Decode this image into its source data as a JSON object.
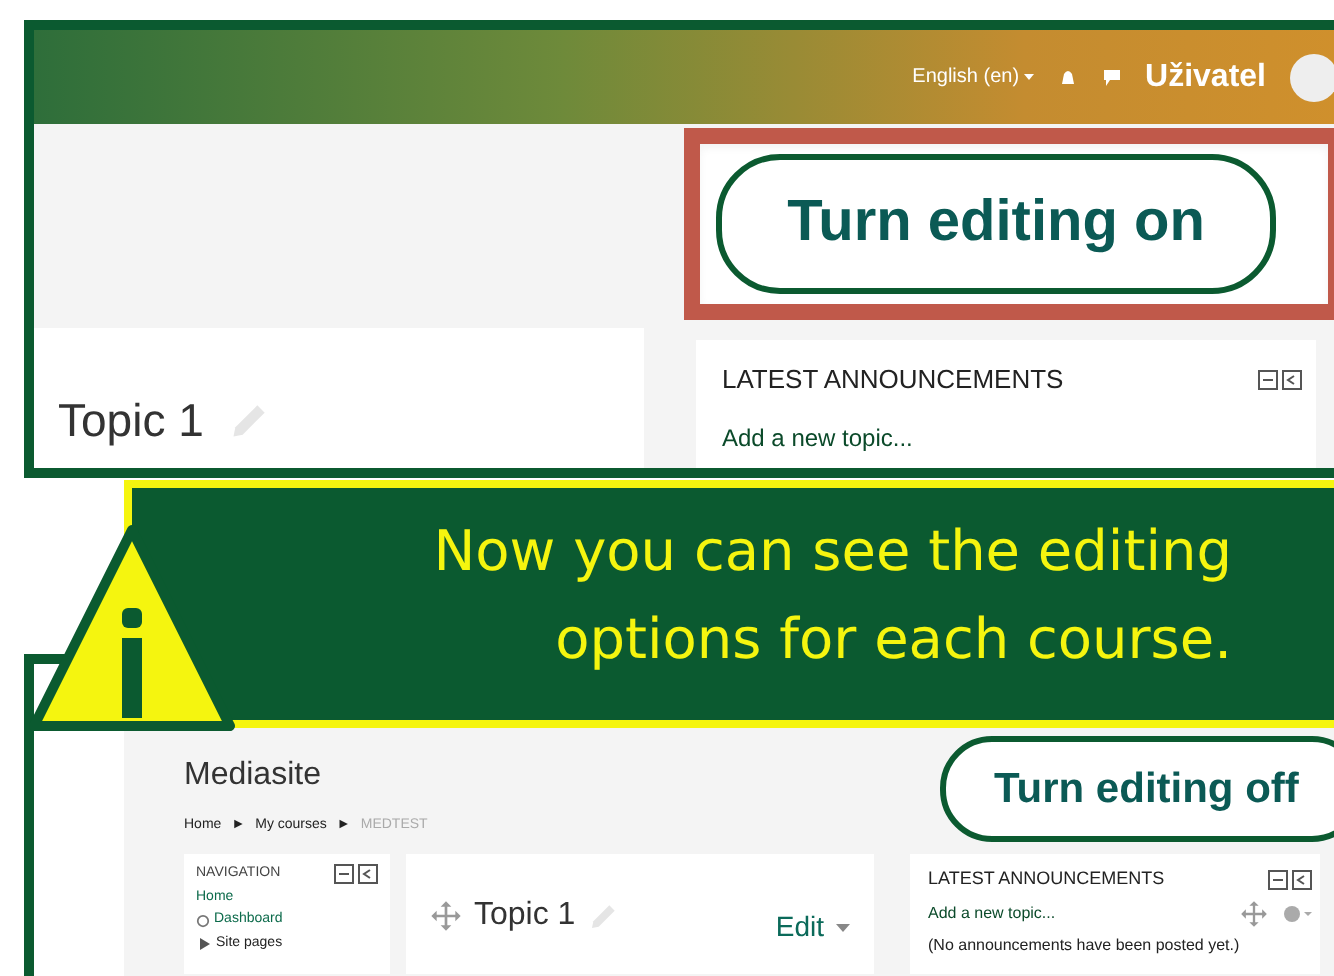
{
  "top_screenshot": {
    "header": {
      "language": "English (en)",
      "user": "Uživatel"
    },
    "edit_button": "Turn editing on",
    "section": {
      "title": "Topic 1"
    },
    "announcements": {
      "title": "LATEST ANNOUNCEMENTS",
      "link": "Add a new topic..."
    }
  },
  "callout": {
    "lines": [
      "Now you can see the editing",
      "options for each course."
    ]
  },
  "bottom_screenshot": {
    "site_title": "Mediasite",
    "breadcrumb_separator": "►",
    "breadcrumb": [
      {
        "label": "Home",
        "current": false
      },
      {
        "label": "My courses",
        "current": false
      },
      {
        "label": "MEDTEST",
        "current": true
      }
    ],
    "edit_button": "Turn editing off",
    "navigation": {
      "title": "NAVIGATION",
      "items": [
        {
          "label": "Home",
          "kind": "link"
        },
        {
          "label": "Dashboard",
          "kind": "icon"
        },
        {
          "label": "Site pages",
          "kind": "branch"
        }
      ]
    },
    "section": {
      "title": "Topic 1",
      "menu": "Edit"
    },
    "announcements": {
      "title": "LATEST ANNOUNCEMENTS",
      "link": "Add a new topic...",
      "note": "(No announcements have been posted yet.)"
    }
  }
}
